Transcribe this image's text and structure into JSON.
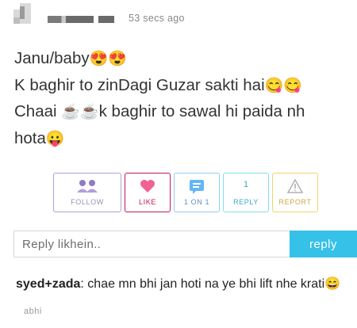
{
  "header": {
    "timestamp": "53 secs ago"
  },
  "post": {
    "lines": [
      "Janu/baby",
      "K baghir to zinDagi Guzar sakti hai",
      "Chaai ",
      "hota"
    ],
    "emoji": {
      "heart_eyes": "😍",
      "yum": "😋",
      "coffee": "☕",
      "tongue": "😛"
    },
    "line3_rest": "k baghir to sawal hi paida nh"
  },
  "actions": {
    "follow": "FOLLOW",
    "like": "LIKE",
    "one_on_one": "1 ON 1",
    "reply": "REPLY",
    "reply_count": "1",
    "report": "REPORT"
  },
  "reply_box": {
    "placeholder": "Reply likhein..",
    "button": "reply"
  },
  "comment": {
    "author": "syed+zada",
    "separator": ":",
    "text": " chae mn bhi jan hoti na ye bhi lift nhe krati",
    "emoji": "😄",
    "time": "abhi"
  }
}
